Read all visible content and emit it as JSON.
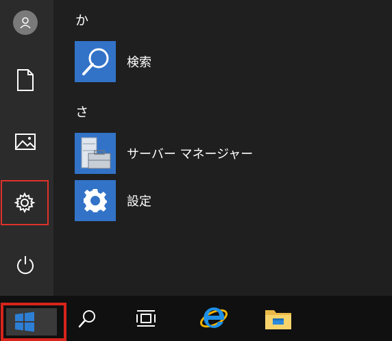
{
  "start_menu": {
    "sections": [
      {
        "letter": "か",
        "apps": [
          {
            "label": "検索",
            "icon": "search-icon"
          }
        ]
      },
      {
        "letter": "さ",
        "apps": [
          {
            "label": "サーバー マネージャー",
            "icon": "server-manager-icon"
          },
          {
            "label": "設定",
            "icon": "gear-icon"
          }
        ]
      }
    ],
    "left_rail": [
      "user-avatar-icon",
      "documents-icon",
      "pictures-icon",
      "settings-icon",
      "power-icon"
    ]
  },
  "taskbar": {
    "items": [
      "windows-logo-icon",
      "search-icon",
      "task-view-icon",
      "internet-explorer-icon",
      "file-explorer-icon"
    ]
  },
  "colors": {
    "tile": "#3273c8",
    "highlight_border": "#e0312a",
    "background": "#1f1f1f",
    "taskbar": "#101010"
  }
}
